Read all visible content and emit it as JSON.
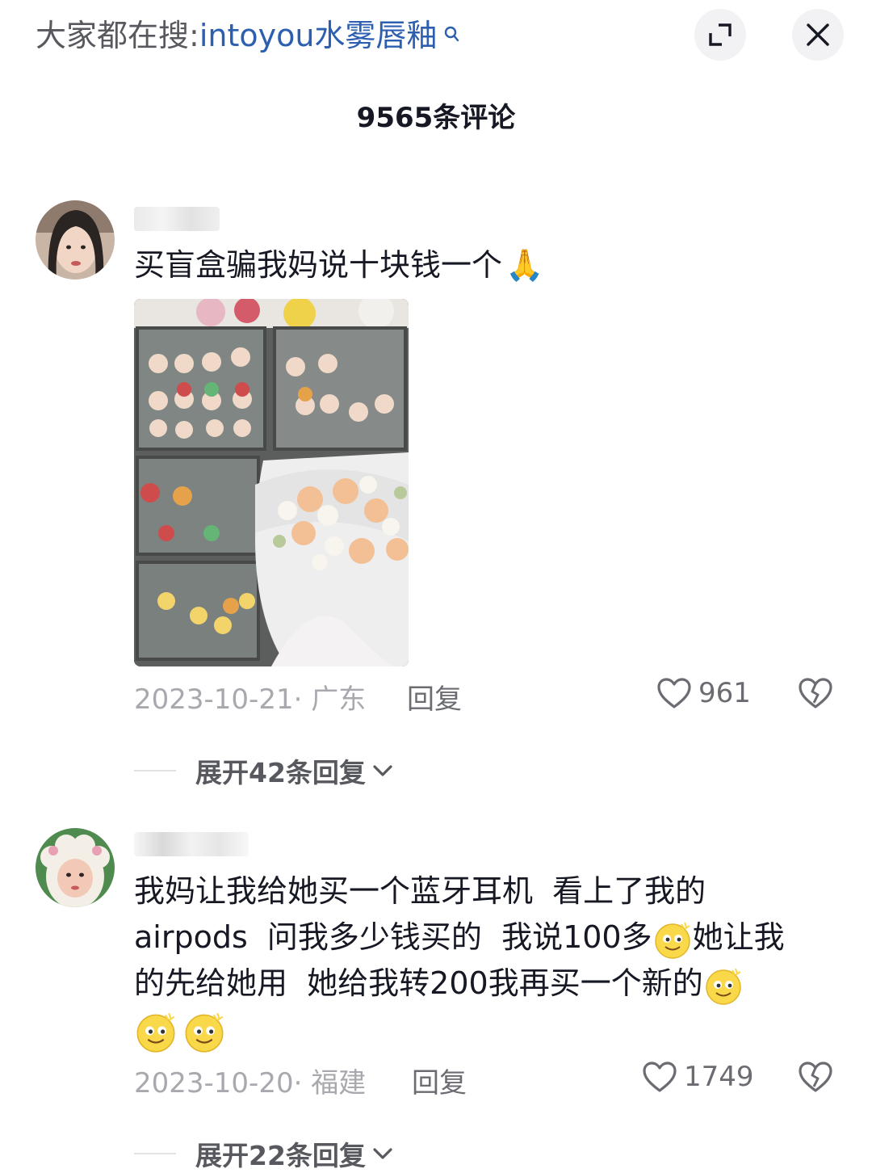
{
  "header": {
    "search_prefix": "大家都在搜:",
    "search_query": "intoyou水雾唇釉",
    "search_icon": "search-icon",
    "expand_icon": "expand-icon",
    "close_icon": "close-icon"
  },
  "comments_header": {
    "count_label": "9565条评论"
  },
  "comments": [
    {
      "text": "买盲盒骗我妈说十块钱一个",
      "emoji": "🙏",
      "date_location": "2023-10-21· 广东",
      "reply_label": "回复",
      "likes": "961",
      "expand_label": "展开42条回复"
    },
    {
      "text_lines": [
        "我妈让我给她买一个蓝牙耳机  看上了我的",
        "airpods  问我多少钱买的  我说100多",
        "她让我",
        "的先给她用  她给我转200我再买一个新的"
      ],
      "date_location": "2023-10-20· 福建",
      "reply_label": "回复",
      "likes": "1749",
      "expand_label": "展开22条回复"
    }
  ],
  "colors": {
    "accent_link": "#2d5fb0",
    "text_primary": "#161823",
    "text_meta": "#a8a9ae"
  }
}
